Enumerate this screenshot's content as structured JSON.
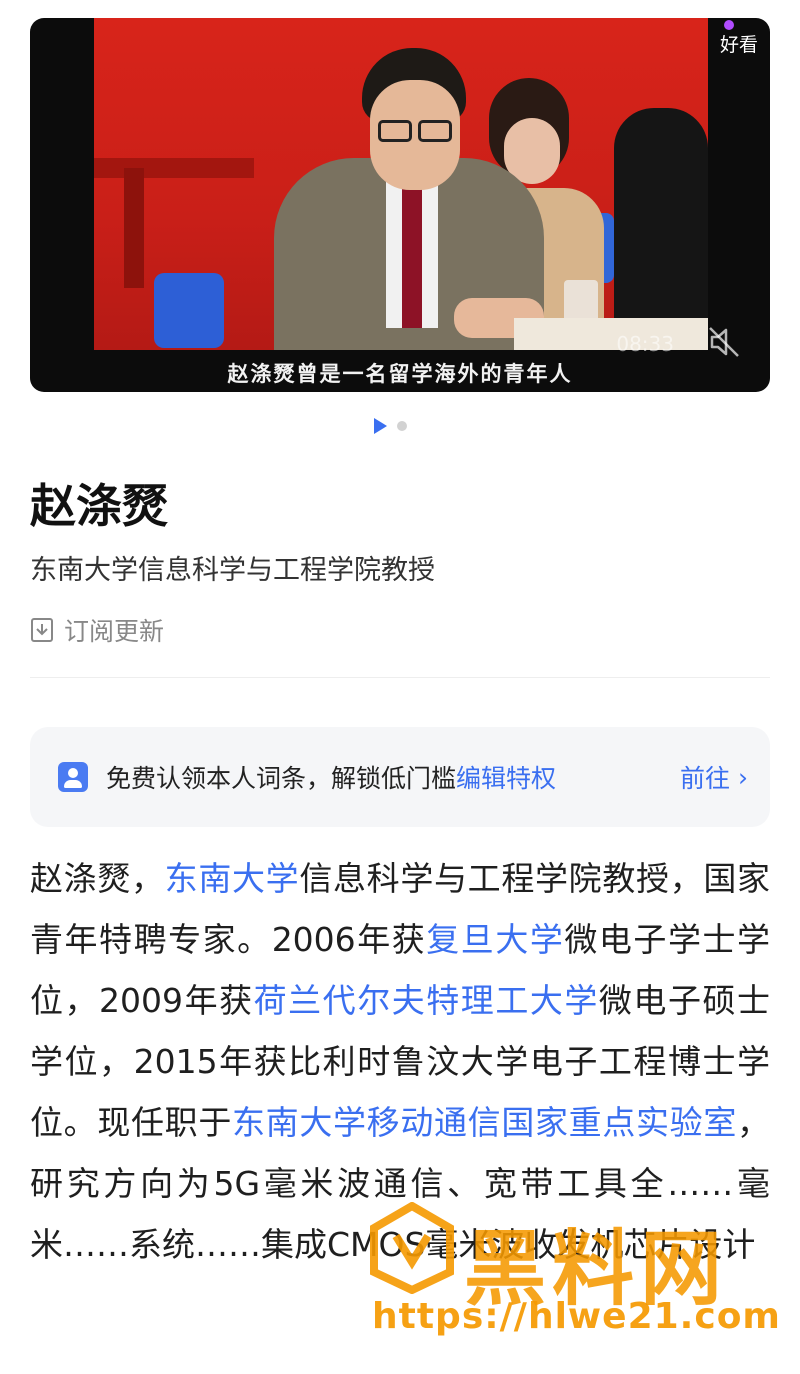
{
  "video": {
    "logo_text": "好看",
    "time": "08:33",
    "caption": "赵涤燹曾是一名留学海外的青年人"
  },
  "profile": {
    "name": "赵涤燹",
    "title": "东南大学信息科学与工程学院教授",
    "subscribe_label": "订阅更新"
  },
  "claim": {
    "text": "免费认领本人词条，解锁低门槛",
    "link": "编辑特权",
    "go_label": "前往",
    "go_chevron": "›"
  },
  "summary": {
    "p1": "赵涤燹，",
    "l1": "东南大学",
    "p2": "信息科学与工程学院教授，国家青年特聘专家。2006年获",
    "l2": "复旦大学",
    "p3": "微电子学士学位，2009年获",
    "l3": "荷兰代尔夫特理工大学",
    "p4": "微电子硕士学位，2015年获比利时鲁汶大学电子工程博士学位。现任职于",
    "l4": "东南大学移动通信国家重点实验室",
    "p5": "，研究方向为5G毫米波通信、宽带工具全……毫米……系统……集成CMOS毫米波收发机芯片设计"
  },
  "watermark": {
    "text": "黑料网",
    "url": "https://hlwe21.com"
  },
  "colors": {
    "accent": "#3a6ff0",
    "watermark": "#f59900"
  },
  "icons": {
    "mute": "mute-icon",
    "subscribe": "subscribe-icon",
    "claim": "user-card-icon",
    "pager": "play-icon"
  }
}
